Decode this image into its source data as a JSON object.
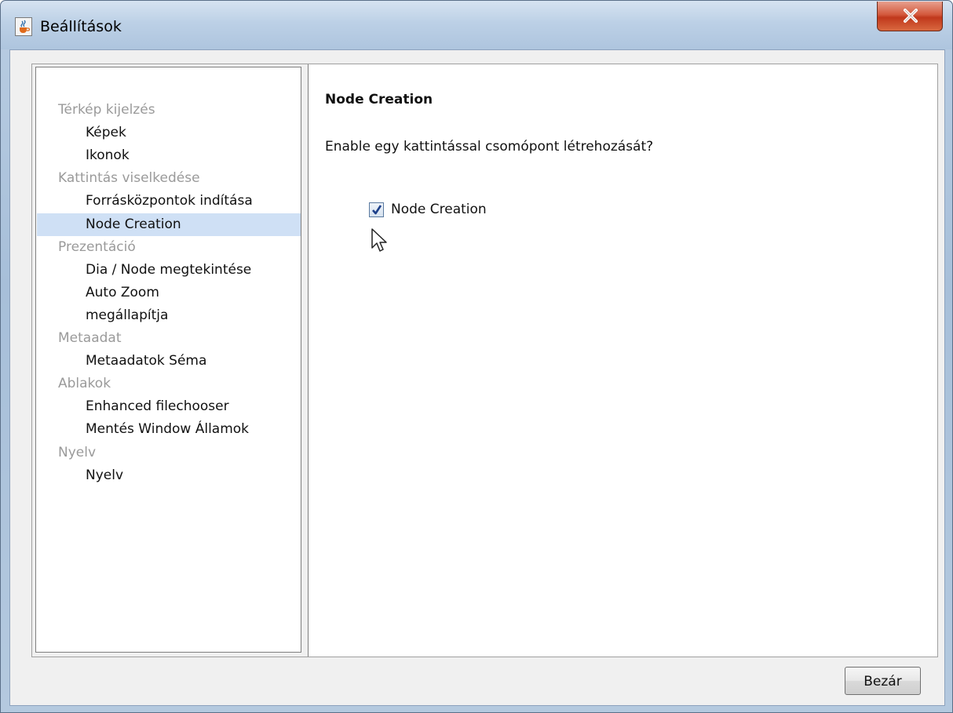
{
  "window": {
    "title": "Beállítások",
    "icon": "java-cup-icon",
    "close_icon": "close-x-icon"
  },
  "tree": {
    "selected_index": 4,
    "items": [
      {
        "label": "Térkép kijelzés",
        "kind": "category"
      },
      {
        "label": "Képek",
        "kind": "leaf"
      },
      {
        "label": "Ikonok",
        "kind": "leaf"
      },
      {
        "label": "Kattintás viselkedése",
        "kind": "category"
      },
      {
        "label": "Forrásközpontok indítása",
        "kind": "leaf"
      },
      {
        "label": "Node Creation",
        "kind": "leaf"
      },
      {
        "label": "Prezentáció",
        "kind": "category"
      },
      {
        "label": "Dia / Node megtekintése",
        "kind": "leaf"
      },
      {
        "label": "Auto Zoom",
        "kind": "leaf"
      },
      {
        "label": "megállapítja",
        "kind": "leaf"
      },
      {
        "label": "Metaadat",
        "kind": "category"
      },
      {
        "label": "Metaadatok Séma",
        "kind": "leaf"
      },
      {
        "label": "Ablakok",
        "kind": "category"
      },
      {
        "label": "Enhanced filechooser",
        "kind": "leaf"
      },
      {
        "label": "Mentés Window Államok",
        "kind": "leaf"
      },
      {
        "label": "Nyelv",
        "kind": "category"
      },
      {
        "label": "Nyelv",
        "kind": "leaf"
      }
    ]
  },
  "content": {
    "title": "Node Creation",
    "question": "Enable egy kattintással csomópont létrehozását?",
    "checkbox": {
      "label": "Node Creation",
      "checked": true
    }
  },
  "footer": {
    "close_label": "Bezár"
  },
  "colors": {
    "selection": "#cfe0f5",
    "category_text": "#9a9a9a",
    "close_button_red": "#c0381c"
  }
}
